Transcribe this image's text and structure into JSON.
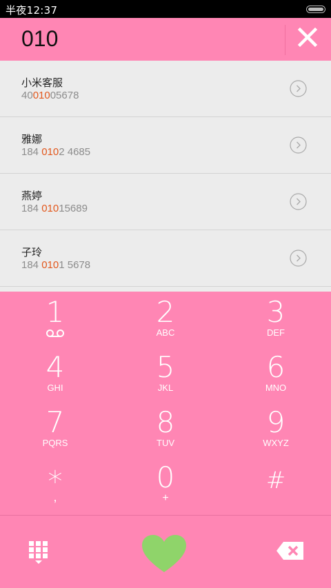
{
  "status_bar": {
    "time": "半夜12:37"
  },
  "dialer": {
    "input_value": "010"
  },
  "results": [
    {
      "name": "小米客服",
      "number_pre": "40",
      "number_match": "010",
      "number_post": "05678"
    },
    {
      "name": "雅娜",
      "number_pre": "184 ",
      "number_match": "010",
      "number_post": "2 4685"
    },
    {
      "name": "燕婷",
      "number_pre": "184 ",
      "number_match": "010",
      "number_post": "15689"
    },
    {
      "name": "子玲",
      "number_pre": "184 ",
      "number_match": "010",
      "number_post": "1 5678"
    }
  ],
  "keypad": {
    "keys": [
      {
        "digit": "1",
        "letters": ""
      },
      {
        "digit": "2",
        "letters": "ABC"
      },
      {
        "digit": "3",
        "letters": "DEF"
      },
      {
        "digit": "4",
        "letters": "GHI"
      },
      {
        "digit": "5",
        "letters": "JKL"
      },
      {
        "digit": "6",
        "letters": "MNO"
      },
      {
        "digit": "7",
        "letters": "PQRS"
      },
      {
        "digit": "8",
        "letters": "TUV"
      },
      {
        "digit": "9",
        "letters": "WXYZ"
      },
      {
        "digit": "*",
        "letters": ","
      },
      {
        "digit": "0",
        "letters": "+"
      },
      {
        "digit": "#",
        "letters": ""
      }
    ]
  },
  "icons": {
    "clear": "close-icon",
    "detail": "chevron-right-circle-icon",
    "voicemail": "voicemail-icon",
    "keypad_toggle": "keypad-icon",
    "call": "heart-call-icon",
    "backspace": "backspace-icon"
  },
  "colors": {
    "accent_pink": "#ff86b4",
    "highlight_orange": "#e2571c",
    "call_green": "#8fd46a",
    "list_background": "#ececec"
  }
}
